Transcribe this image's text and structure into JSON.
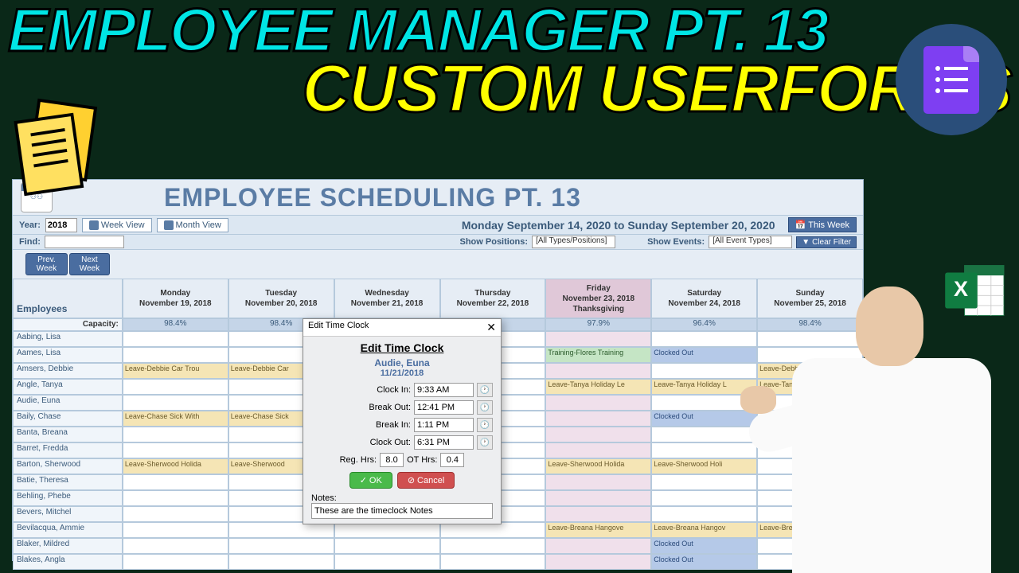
{
  "thumbnail": {
    "title1": "EMPLOYEE MANAGER PT. 13",
    "title2": "CUSTOM USERFORMS"
  },
  "app": {
    "header_title": "EMPLOYEE SCHEDULING PT. 13",
    "year_label": "Year:",
    "year_value": "2018",
    "week_view": "Week View",
    "month_view": "Month View",
    "date_range": "Monday September 14, 2020 to Sunday September 20, 2020",
    "this_week": "This Week",
    "find_label": "Find:",
    "show_positions_label": "Show Positions:",
    "positions_value": "[All Types/Positions]",
    "show_events_label": "Show Events:",
    "events_value": "[All Event Types]",
    "clear_filter": "Clear Filter",
    "prev_week": "Prev. Week",
    "next_week": "Next Week",
    "employees_label": "Employees",
    "capacity_label": "Capacity:",
    "days": [
      {
        "name": "Monday",
        "date": "November 19, 2018",
        "extra": "",
        "capacity": "98.4%"
      },
      {
        "name": "Tuesday",
        "date": "November 20, 2018",
        "extra": "",
        "capacity": "98.4%"
      },
      {
        "name": "Wednesday",
        "date": "November 21, 2018",
        "extra": "",
        "capacity": ""
      },
      {
        "name": "Thursday",
        "date": "November 22, 2018",
        "extra": "",
        "capacity": ""
      },
      {
        "name": "Friday",
        "date": "November 23, 2018",
        "extra": "Thanksgiving",
        "capacity": "97.9%"
      },
      {
        "name": "Saturday",
        "date": "November 24, 2018",
        "extra": "",
        "capacity": "96.4%"
      },
      {
        "name": "Sunday",
        "date": "November 25, 2018",
        "extra": "",
        "capacity": "98.4%"
      }
    ],
    "employees": [
      {
        "name": "Aabing, Lisa",
        "cells": [
          "",
          "",
          "",
          "",
          "",
          "",
          ""
        ]
      },
      {
        "name": "Aames, Lisa",
        "cells": [
          "",
          "",
          "",
          "",
          "Training-Flores Training",
          "Clocked Out",
          ""
        ]
      },
      {
        "name": "Amsers, Debbie",
        "cells": [
          "Leave-Debbie Car Trou",
          "Leave-Debbie Car",
          "",
          "",
          "",
          "",
          "Leave-Debbie No Show Leave"
        ]
      },
      {
        "name": "Angle, Tanya",
        "cells": [
          "",
          "",
          "",
          "",
          "Leave-Tanya Holiday Le",
          "Leave-Tanya Holiday L",
          "Leave-Tanya Holiday Leave"
        ]
      },
      {
        "name": "Audie, Euna",
        "cells": [
          "",
          "",
          "",
          "",
          "",
          "",
          ""
        ]
      },
      {
        "name": "Baily, Chase",
        "cells": [
          "Leave-Chase Sick With",
          "Leave-Chase Sick",
          "",
          "",
          "",
          "Clocked Out",
          ""
        ]
      },
      {
        "name": "Banta, Breana",
        "cells": [
          "",
          "",
          "",
          "",
          "",
          "",
          ""
        ]
      },
      {
        "name": "Barret, Fredda",
        "cells": [
          "",
          "",
          "",
          "",
          "",
          "",
          ""
        ]
      },
      {
        "name": "Barton, Sherwood",
        "cells": [
          "Leave-Sherwood Holida",
          "Leave-Sherwood",
          "",
          "",
          "Leave-Sherwood Holida",
          "Leave-Sherwood Holi",
          ""
        ]
      },
      {
        "name": "Batie, Theresa",
        "cells": [
          "",
          "",
          "",
          "",
          "",
          "",
          ""
        ]
      },
      {
        "name": "Behling, Phebe",
        "cells": [
          "",
          "",
          "",
          "",
          "",
          "",
          ""
        ]
      },
      {
        "name": "Bevers, Mitchel",
        "cells": [
          "",
          "",
          "",
          "",
          "",
          "",
          ""
        ]
      },
      {
        "name": "Bevilacqua, Ammie",
        "cells": [
          "",
          "",
          "",
          "",
          "Leave-Breana Hangove",
          "Leave-Breana Hangov",
          "Leave-Breana Han"
        ]
      },
      {
        "name": "Blaker, Mildred",
        "cells": [
          "",
          "",
          "",
          "",
          "",
          "Clocked Out",
          ""
        ]
      },
      {
        "name": "Blakes, Angla",
        "cells": [
          "",
          "",
          "",
          "",
          "",
          "Clocked Out",
          ""
        ]
      }
    ]
  },
  "dialog": {
    "titlebar": "Edit Time Clock",
    "heading": "Edit Time Clock",
    "employee": "Audie, Euna",
    "date": "11/21/2018",
    "clock_in_label": "Clock In:",
    "clock_in": "9:33 AM",
    "break_out_label": "Break Out:",
    "break_out": "12:41 PM",
    "break_in_label": "Break In:",
    "break_in": "1:11 PM",
    "clock_out_label": "Clock Out:",
    "clock_out": "6:31 PM",
    "reg_hrs_label": "Reg. Hrs:",
    "reg_hrs": "8.0",
    "ot_hrs_label": "OT Hrs:",
    "ot_hrs": "0.4",
    "ok": "OK",
    "cancel": "Cancel",
    "notes_label": "Notes:",
    "notes": "These are the timeclock Notes"
  }
}
